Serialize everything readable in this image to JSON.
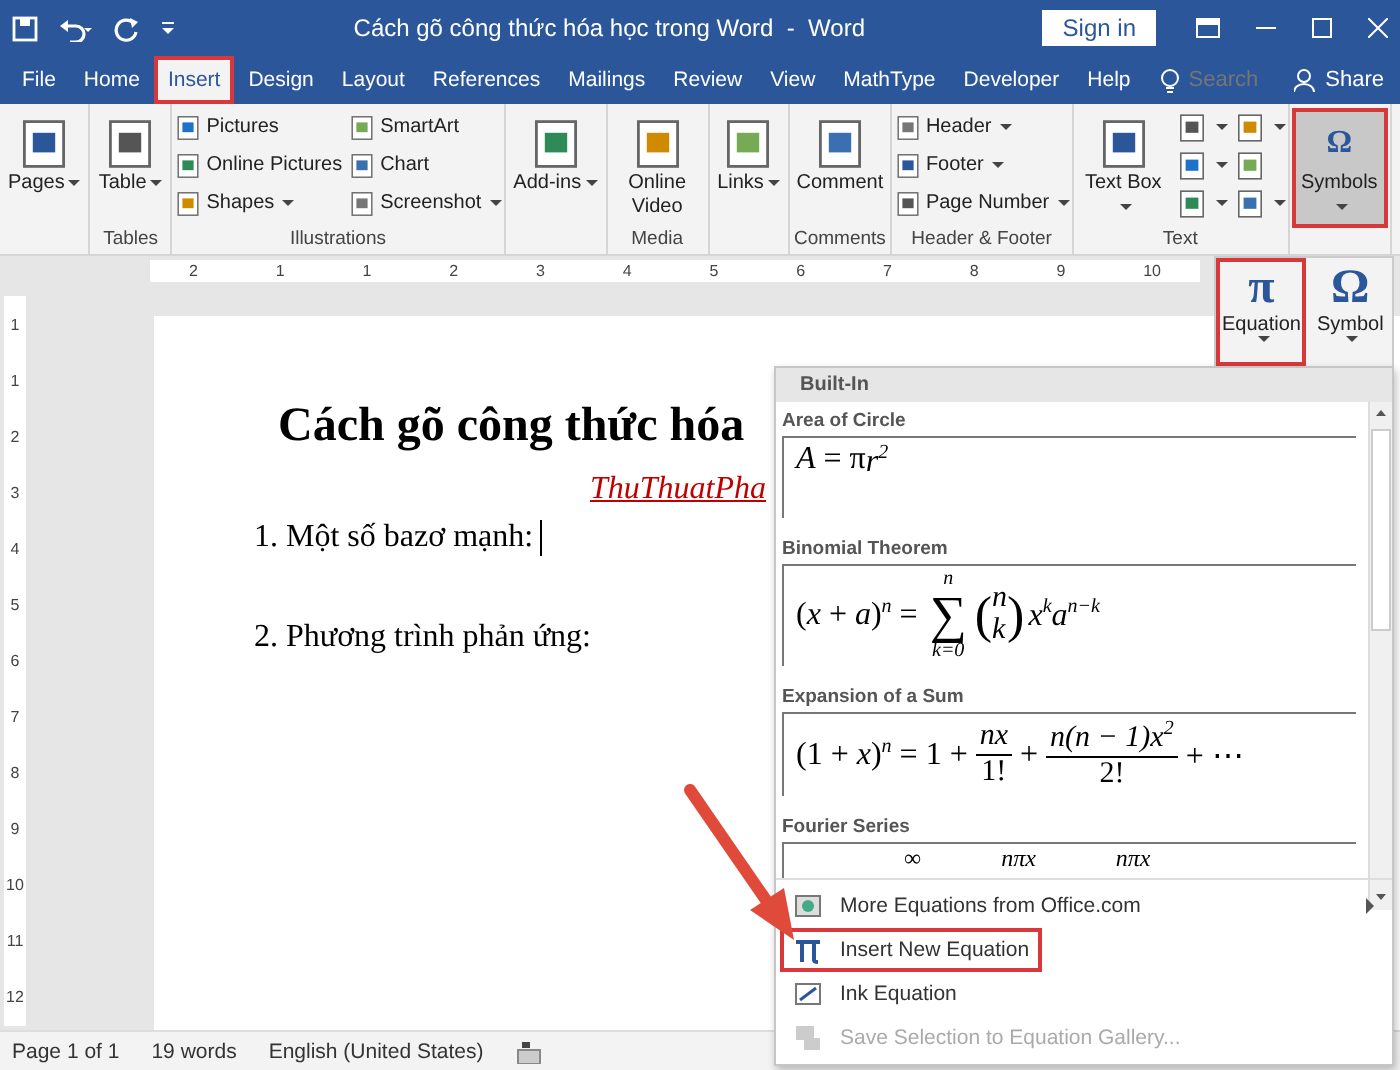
{
  "window": {
    "title": "Cách gõ công thức hóa học trong Word  -  Word",
    "sign_in": "Sign in"
  },
  "tabs": [
    {
      "label": "File",
      "selected": false,
      "highlighted": false
    },
    {
      "label": "Home",
      "selected": false,
      "highlighted": false
    },
    {
      "label": "Insert",
      "selected": true,
      "highlighted": true
    },
    {
      "label": "Design",
      "selected": false,
      "highlighted": false
    },
    {
      "label": "Layout",
      "selected": false,
      "highlighted": false
    },
    {
      "label": "References",
      "selected": false,
      "highlighted": false
    },
    {
      "label": "Mailings",
      "selected": false,
      "highlighted": false
    },
    {
      "label": "Review",
      "selected": false,
      "highlighted": false
    },
    {
      "label": "View",
      "selected": false,
      "highlighted": false
    },
    {
      "label": "MathType",
      "selected": false,
      "highlighted": false
    },
    {
      "label": "Developer",
      "selected": false,
      "highlighted": false
    },
    {
      "label": "Help",
      "selected": false,
      "highlighted": false
    }
  ],
  "search": {
    "placeholder": "Search"
  },
  "share": "Share",
  "ribbon": {
    "groups": [
      {
        "items": [
          {
            "kind": "large",
            "label": "Pages",
            "dropdown": true,
            "pressed": false,
            "highlighted": false
          }
        ]
      },
      {
        "label": "Tables",
        "items": [
          {
            "kind": "large",
            "label": "Table",
            "dropdown": true,
            "pressed": false,
            "highlighted": false
          }
        ]
      },
      {
        "label": "Illustrations",
        "items": [
          {
            "kind": "small",
            "label": "Pictures",
            "dropdown": false
          },
          {
            "kind": "small",
            "label": "Online Pictures",
            "dropdown": false
          },
          {
            "kind": "small",
            "label": "Shapes",
            "dropdown": true
          },
          {
            "kind": "small",
            "label": "SmartArt",
            "dropdown": false
          },
          {
            "kind": "small",
            "label": "Chart",
            "dropdown": false
          },
          {
            "kind": "small",
            "label": "Screenshot",
            "dropdown": true
          }
        ]
      },
      {
        "items": [
          {
            "kind": "large",
            "label": "Add-ins",
            "dropdown": true,
            "pressed": false,
            "highlighted": false
          }
        ]
      },
      {
        "label": "Media",
        "items": [
          {
            "kind": "large",
            "label": "Online Video",
            "dropdown": false,
            "pressed": false,
            "highlighted": false
          }
        ]
      },
      {
        "items": [
          {
            "kind": "large",
            "label": "Links",
            "dropdown": true,
            "pressed": false,
            "highlighted": false
          }
        ]
      },
      {
        "label": "Comments",
        "items": [
          {
            "kind": "large",
            "label": "Comment",
            "dropdown": false,
            "pressed": false,
            "highlighted": false
          }
        ]
      },
      {
        "label": "Header & Footer",
        "items": [
          {
            "kind": "small",
            "label": "Header",
            "dropdown": true
          },
          {
            "kind": "small",
            "label": "Footer",
            "dropdown": true
          },
          {
            "kind": "small",
            "label": "Page Number",
            "dropdown": true
          }
        ]
      },
      {
        "label": "Text",
        "items": [
          {
            "kind": "large",
            "label": "Text Box",
            "dropdown": true,
            "pressed": false,
            "highlighted": false
          },
          {
            "kind": "icon",
            "dropdown": true
          },
          {
            "kind": "icon",
            "dropdown": true
          },
          {
            "kind": "icon",
            "dropdown": true
          },
          {
            "kind": "icon",
            "dropdown": true
          },
          {
            "kind": "icon",
            "dropdown": false
          },
          {
            "kind": "icon",
            "dropdown": true
          }
        ]
      },
      {
        "items": [
          {
            "kind": "large",
            "label": "Symbols",
            "symbol": "Ω",
            "dropdown": true,
            "pressed": true,
            "highlighted": true
          }
        ]
      }
    ]
  },
  "symbols_panel": [
    {
      "symbol": "π",
      "label": "Equation",
      "dropdown": true,
      "highlighted": true
    },
    {
      "symbol": "Ω",
      "label": "Symbol",
      "dropdown": true,
      "highlighted": false
    }
  ],
  "ruler": {
    "horizontal": [
      "2",
      "1",
      "1",
      "2",
      "3",
      "4",
      "5",
      "6",
      "7",
      "8",
      "9",
      "10"
    ],
    "vertical": [
      "1",
      "1",
      "2",
      "3",
      "4",
      "5",
      "6",
      "7",
      "8",
      "9",
      "10",
      "11",
      "12"
    ]
  },
  "document": {
    "title": "Cách gõ công thức hóa",
    "subtitle": "ThuThuatPha",
    "paragraphs": [
      {
        "text": "1. Một số bazơ mạnh:",
        "cursor": true
      },
      {
        "text": "2. Phương trình phản ứng:",
        "cursor": false
      }
    ]
  },
  "equation_menu": {
    "header": "Built-In",
    "gallery": [
      {
        "title": "Area of Circle",
        "parts": [
          {
            "kind": "var",
            "text": "A"
          },
          {
            "kind": "text",
            "text": " = π"
          },
          {
            "kind": "var",
            "text": "r$^{2}$"
          }
        ]
      },
      {
        "title": "Binomial Theorem",
        "parts": [
          {
            "kind": "text",
            "text": "("
          },
          {
            "kind": "var",
            "text": "x"
          },
          {
            "kind": "text",
            "text": " + "
          },
          {
            "kind": "var",
            "text": "a"
          },
          {
            "kind": "text",
            "text": ")"
          },
          {
            "kind": "var",
            "text": "$^{n}$"
          },
          {
            "kind": "text",
            "text": " = "
          },
          {
            "kind": "sum",
            "symbol": "∑",
            "top": "n",
            "bottom": "k=0"
          },
          {
            "kind": "binom",
            "open": "(",
            "close": ")",
            "top": "n",
            "bottom": "k"
          },
          {
            "kind": "var",
            "text": "x$^{k}$a$^{n−k}$"
          }
        ]
      },
      {
        "title": "Expansion of a Sum",
        "parts": [
          {
            "kind": "text",
            "text": "(1 + "
          },
          {
            "kind": "var",
            "text": "x"
          },
          {
            "kind": "text",
            "text": ")"
          },
          {
            "kind": "var",
            "text": "$^{n}$"
          },
          {
            "kind": "text",
            "text": " = 1 + "
          },
          {
            "kind": "frac",
            "num": "nx",
            "den": "1!"
          },
          {
            "kind": "text",
            "text": " + "
          },
          {
            "kind": "frac",
            "num": "n(n − 1)x$^{2}$",
            "den": "2!"
          },
          {
            "kind": "text",
            "text": " + ⋯"
          }
        ]
      },
      {
        "title": "Fourier Series",
        "parts": [
          {
            "kind": "text",
            "text": "∞"
          },
          {
            "kind": "var",
            "text": "nπx"
          },
          {
            "kind": "var",
            "text": "nπx"
          }
        ]
      }
    ],
    "items": [
      {
        "label": "More Equations from Office.com",
        "submenu": true,
        "disabled": false,
        "highlighted": false
      },
      {
        "label": "Insert New Equation",
        "submenu": false,
        "disabled": false,
        "highlighted": true
      },
      {
        "label": "Ink Equation",
        "submenu": false,
        "disabled": false,
        "highlighted": false
      },
      {
        "label": "Save Selection to Equation Gallery...",
        "submenu": false,
        "disabled": true,
        "highlighted": false
      }
    ]
  },
  "status_bar": [
    "Page 1 of 1",
    "19 words",
    "English (United States)"
  ]
}
